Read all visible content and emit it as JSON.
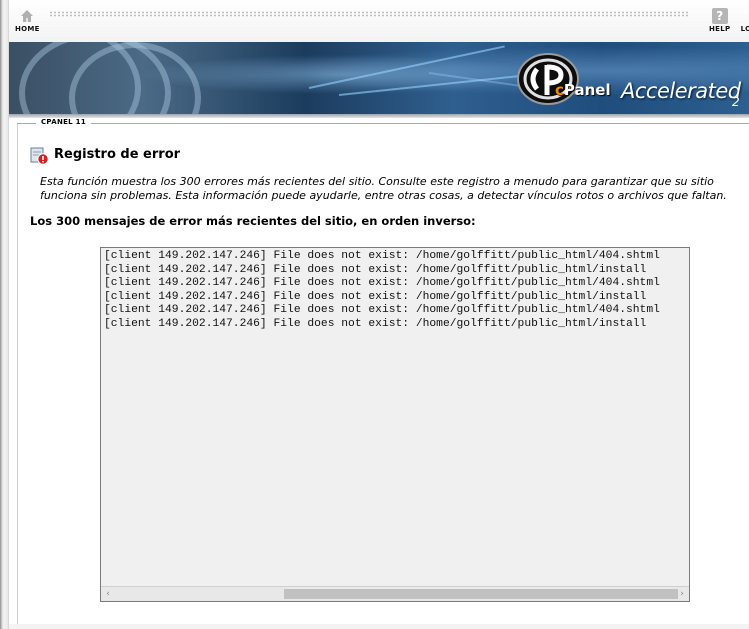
{
  "nav": {
    "home_label": "HOME",
    "help_label": "HELP",
    "logout_label": "LO",
    "help_glyph": "?"
  },
  "banner": {
    "brand_name": "Panel",
    "brand_prefix": "c",
    "brand_tagline": "Accelerated",
    "brand_version": "2"
  },
  "section": {
    "label": "CPANEL 11"
  },
  "page": {
    "title": "Registro de error",
    "description": "Esta función muestra los 300 errores más recientes del sitio. Consulte este registro a menudo para garantizar que su sitio funciona sin problemas. Esta información puede ayudarle, entre otras cosas, a detectar vínculos rotos o archivos que faltan.",
    "log_heading": "Los 300 mensajes de error más recientes del sitio, en orden inverso:"
  },
  "log": {
    "lines": [
      "[client 149.202.147.246] File does not exist: /home/golffitt/public_html/404.shtml",
      "[client 149.202.147.246] File does not exist: /home/golffitt/public_html/install",
      "[client 149.202.147.246] File does not exist: /home/golffitt/public_html/404.shtml",
      "[client 149.202.147.246] File does not exist: /home/golffitt/public_html/install",
      "[client 149.202.147.246] File does not exist: /home/golffitt/public_html/404.shtml",
      "[client 149.202.147.246] File does not exist: /home/golffitt/public_html/install"
    ],
    "scroll_left": "‹",
    "scroll_right": "›"
  },
  "icons": {
    "home": "home-icon",
    "help": "help-icon",
    "page": "error-log-icon"
  },
  "colors": {
    "brand_orange": "#f08a00",
    "banner_blue": "#1f4d7d"
  }
}
